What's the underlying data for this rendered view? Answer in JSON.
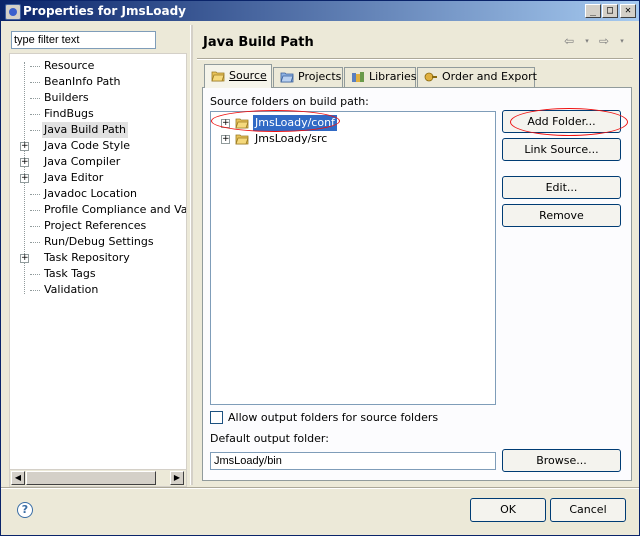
{
  "window": {
    "title": "Properties for JmsLoady",
    "minimize_glyph": "_",
    "maximize_glyph": "□",
    "close_glyph": "✕"
  },
  "filter": {
    "value": "type filter text"
  },
  "tree": {
    "items": [
      {
        "label": "Resource",
        "expandable": false
      },
      {
        "label": "BeanInfo Path",
        "expandable": false
      },
      {
        "label": "Builders",
        "expandable": false
      },
      {
        "label": "FindBugs",
        "expandable": false
      },
      {
        "label": "Java Build Path",
        "expandable": false,
        "selected": true
      },
      {
        "label": "Java Code Style",
        "expandable": true
      },
      {
        "label": "Java Compiler",
        "expandable": true
      },
      {
        "label": "Java Editor",
        "expandable": true
      },
      {
        "label": "Javadoc Location",
        "expandable": false
      },
      {
        "label": "Profile Compliance and Validatic",
        "expandable": false
      },
      {
        "label": "Project References",
        "expandable": false
      },
      {
        "label": "Run/Debug Settings",
        "expandable": false
      },
      {
        "label": "Task Repository",
        "expandable": true
      },
      {
        "label": "Task Tags",
        "expandable": false
      },
      {
        "label": "Validation",
        "expandable": false
      }
    ]
  },
  "page": {
    "title": "Java Build Path",
    "nav_back_glyph": "⇦",
    "nav_forward_glyph": "⇨",
    "nav_dropdown_glyph": "▾"
  },
  "tabs": [
    {
      "label": "Source",
      "icon": "source-folder-icon",
      "active": true
    },
    {
      "label": "Projects",
      "icon": "projects-icon",
      "active": false
    },
    {
      "label": "Libraries",
      "icon": "libraries-icon",
      "active": false
    },
    {
      "label": "Order and Export",
      "icon": "order-export-icon",
      "active": false
    }
  ],
  "source": {
    "list_label": "Source folders on build path:",
    "folders": [
      {
        "name": "JmsLoady/conf",
        "selected": true
      },
      {
        "name": "JmsLoady/src",
        "selected": false
      }
    ],
    "buttons": {
      "add_folder": "Add Folder...",
      "link_source": "Link Source...",
      "edit": "Edit...",
      "remove": "Remove"
    },
    "allow_output_label": "Allow output folders for source folders",
    "allow_output_checked": false,
    "default_output_label": "Default output folder:",
    "default_output_value": "JmsLoady/bin",
    "browse": "Browse..."
  },
  "dialog": {
    "help_glyph": "?",
    "ok": "OK",
    "cancel": "Cancel"
  },
  "colors": {
    "selection": "#316ac5",
    "annotation_red": "#e11111"
  }
}
